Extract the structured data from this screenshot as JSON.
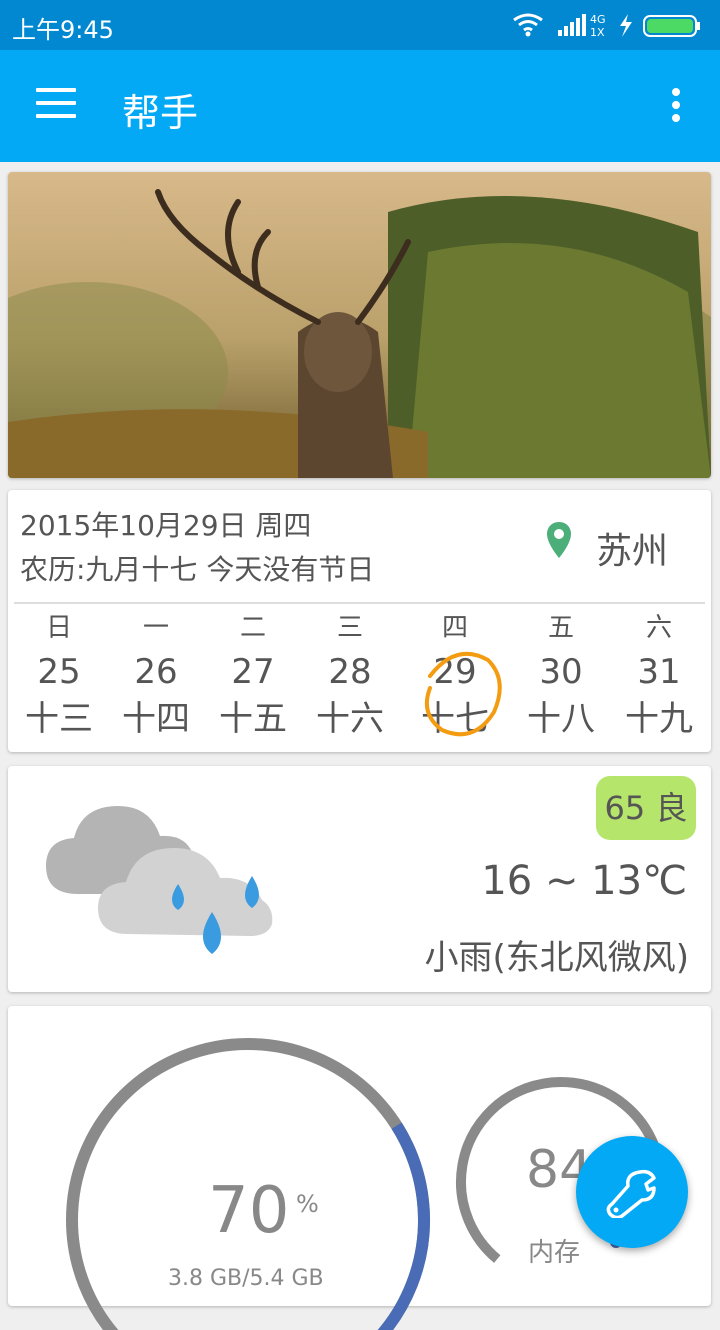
{
  "status_bar": {
    "time": "上午9:45",
    "network": "4G",
    "network_sub": "1X"
  },
  "app_bar": {
    "title": "帮手"
  },
  "banner": {
    "page_count": 4,
    "active_page": 2
  },
  "calendar": {
    "date_line": "2015年10月29日 周四",
    "lunar_line": "农历:九月十七 今天没有节日",
    "city": "苏州",
    "days": [
      {
        "weekday": "日",
        "day": "25",
        "lunar": "十三"
      },
      {
        "weekday": "一",
        "day": "26",
        "lunar": "十四"
      },
      {
        "weekday": "二",
        "day": "27",
        "lunar": "十五"
      },
      {
        "weekday": "三",
        "day": "28",
        "lunar": "十六"
      },
      {
        "weekday": "四",
        "day": "29",
        "lunar": "十七",
        "today": true
      },
      {
        "weekday": "五",
        "day": "30",
        "lunar": "十八"
      },
      {
        "weekday": "六",
        "day": "31",
        "lunar": "十九"
      }
    ]
  },
  "weather": {
    "aqi": "65 良",
    "temperature": "16 ~ 13℃",
    "condition": "小雨(东北风微风)",
    "icon": "rain-cloud-icon"
  },
  "system": {
    "storage_percent": "70",
    "storage_percent_sign": "%",
    "storage_detail": "3.8 GB/5.4 GB",
    "storage_fill": 0.7,
    "memory_percent": "84",
    "memory_label": "内存",
    "memory_fill": 0.84
  },
  "fab": {
    "icon": "wrench-icon"
  },
  "colors": {
    "status_bar": "#0288d1",
    "app_bar": "#03a9f4",
    "aqi_good": "#b5e56b",
    "gauge_track": "#8a8a8a",
    "gauge_fill": "#4a6bb5",
    "today_mark": "#f39c12"
  }
}
